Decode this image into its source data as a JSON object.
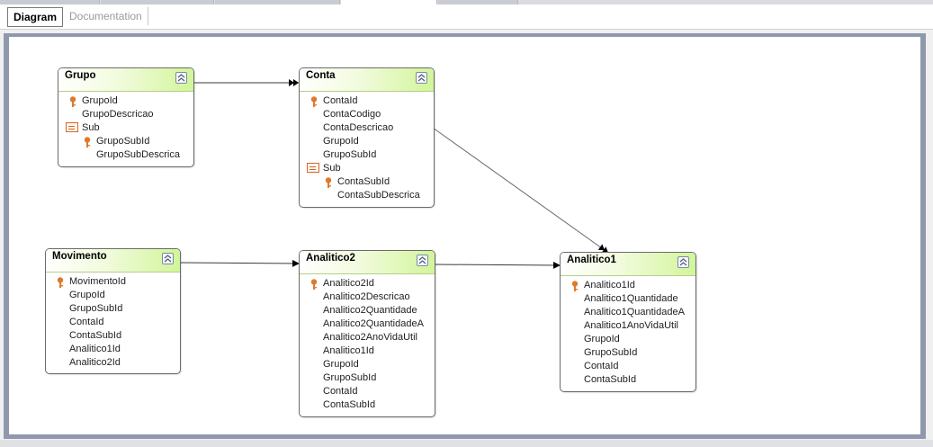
{
  "tabs": {
    "diagram": "Diagram",
    "documentation": "Documentation"
  },
  "entities": {
    "grupo": {
      "title": "Grupo",
      "attributes": [
        {
          "label": "GrupoId",
          "key": true
        },
        {
          "label": "GrupoDescricao"
        },
        {
          "label": "Sub",
          "sub": true
        },
        {
          "label": "GrupoSubId",
          "key": true,
          "nested": true
        },
        {
          "label": "GrupoSubDescrica",
          "nested": true
        }
      ]
    },
    "conta": {
      "title": "Conta",
      "attributes": [
        {
          "label": "ContaId",
          "key": true
        },
        {
          "label": "ContaCodigo"
        },
        {
          "label": "ContaDescricao"
        },
        {
          "label": "GrupoId"
        },
        {
          "label": "GrupoSubId"
        },
        {
          "label": "Sub",
          "sub": true
        },
        {
          "label": "ContaSubId",
          "key": true,
          "nested": true
        },
        {
          "label": "ContaSubDescrica",
          "nested": true
        }
      ]
    },
    "movimento": {
      "title": "Movimento",
      "attributes": [
        {
          "label": "MovimentoId",
          "key": true
        },
        {
          "label": "GrupoId"
        },
        {
          "label": "GrupoSubId"
        },
        {
          "label": "ContaId"
        },
        {
          "label": "ContaSubId"
        },
        {
          "label": "Analitico1Id"
        },
        {
          "label": "Analitico2Id"
        }
      ]
    },
    "analitico2": {
      "title": "Analitico2",
      "attributes": [
        {
          "label": "Analitico2Id",
          "key": true
        },
        {
          "label": "Analitico2Descricao"
        },
        {
          "label": "Analitico2Quantidade"
        },
        {
          "label": "Analitico2QuantidadeA"
        },
        {
          "label": "Analitico2AnoVidaUtil"
        },
        {
          "label": "Analitico1Id"
        },
        {
          "label": "GrupoId"
        },
        {
          "label": "GrupoSubId"
        },
        {
          "label": "ContaId"
        },
        {
          "label": "ContaSubId"
        }
      ]
    },
    "analitico1": {
      "title": "Analitico1",
      "attributes": [
        {
          "label": "Analitico1Id",
          "key": true
        },
        {
          "label": "Analitico1Quantidade"
        },
        {
          "label": "Analitico1QuantidadeA"
        },
        {
          "label": "Analitico1AnoVidaUtil"
        },
        {
          "label": "GrupoId"
        },
        {
          "label": "GrupoSubId"
        },
        {
          "label": "ContaId"
        },
        {
          "label": "ContaSubId"
        }
      ]
    }
  },
  "icons": {
    "key": "key-icon",
    "sub": "subtype-icon",
    "collapse": "collapse-up-icon"
  },
  "colors": {
    "header_green": "#d2f59a",
    "key_orange": "#e07a2a",
    "frame": "#8f98ad"
  }
}
